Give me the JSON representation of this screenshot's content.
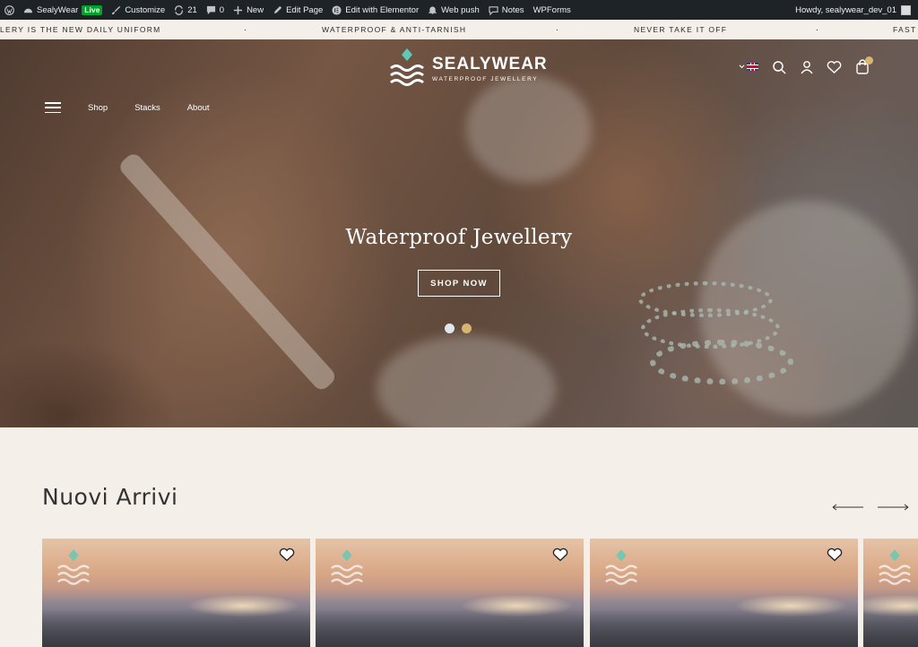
{
  "adminbar": {
    "site_name": "SealyWear",
    "live_badge": "Live",
    "customize": "Customize",
    "updates_count": "21",
    "comments_count": "0",
    "new": "New",
    "edit_page": "Edit Page",
    "edit_elementor": "Edit with Elementor",
    "web_push": "Web push",
    "notes": "Notes",
    "wpforms": "WPForms",
    "howdy": "Howdy, sealywear_dev_01"
  },
  "marquee": {
    "items": [
      "LERY IS THE NEW DAILY UNIFORM",
      "WATERPROOF & ANTI-TARNISH",
      "NEVER TAKE IT OFF",
      "FAST I"
    ],
    "separator": "."
  },
  "nav": {
    "shop": "Shop",
    "stacks": "Stacks",
    "about": "About"
  },
  "logo": {
    "name": "SEALYWEAR",
    "tagline": "WATERPROOF JEWELLERY"
  },
  "hero": {
    "title": "Waterproof Jewellery",
    "button": "SHOP NOW",
    "slides_total": 2,
    "active_slide": 1
  },
  "section": {
    "title": "Nuovi Arrivi"
  },
  "colors": {
    "admin_bar": "#1d2327",
    "background": "#f4efe8",
    "accent_teal": "#5ec9b8",
    "accent_gold": "#d8b56c"
  },
  "icons": [
    "wordpress-icon",
    "dashboard-icon",
    "brush-icon",
    "updates-icon",
    "comment-icon",
    "plus-icon",
    "pencil-icon",
    "elementor-icon",
    "bell-icon",
    "notes-icon",
    "menu-icon",
    "search-icon",
    "user-icon",
    "heart-icon",
    "bag-icon",
    "arrow-left-icon",
    "arrow-right-icon"
  ]
}
